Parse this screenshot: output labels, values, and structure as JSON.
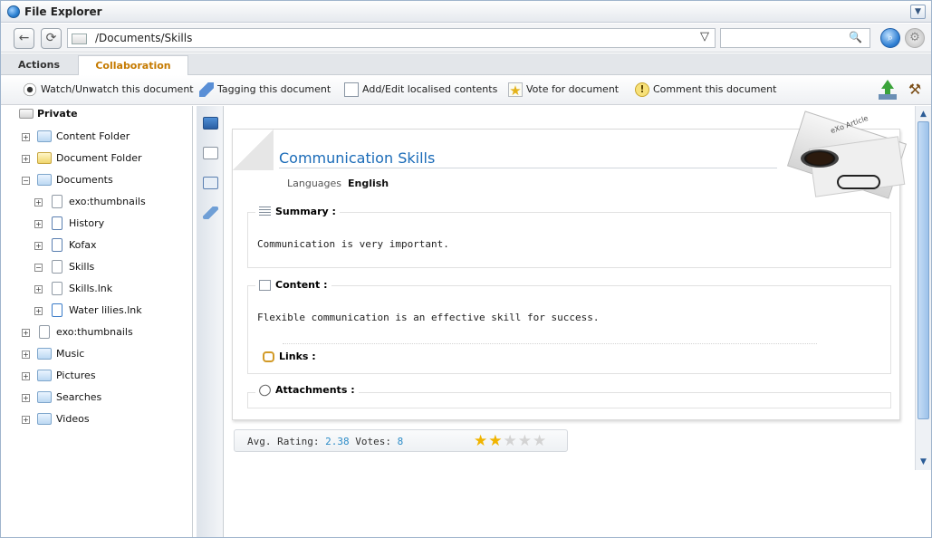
{
  "window": {
    "title": "File Explorer"
  },
  "address": {
    "path": "/Documents/Skills",
    "search_placeholder": ""
  },
  "tabs": [
    {
      "label": "Actions"
    },
    {
      "label": "Collaboration"
    }
  ],
  "toolbar": {
    "items": [
      {
        "label": "Watch/Unwatch this document",
        "icon": "eye-icon"
      },
      {
        "label": "Tagging this document",
        "icon": "tag-icon"
      },
      {
        "label": "Add/Edit localised contents",
        "icon": "localised-doc-icon"
      },
      {
        "label": "Vote for document",
        "icon": "vote-star-icon"
      },
      {
        "label": "Comment this document",
        "icon": "comment-icon"
      }
    ]
  },
  "tree": {
    "root": "Private",
    "items": [
      {
        "label": "Content Folder",
        "level": 1,
        "expanded": false
      },
      {
        "label": "Document Folder",
        "level": 1,
        "expanded": false
      },
      {
        "label": "Documents",
        "level": 1,
        "expanded": true
      },
      {
        "label": "exo:thumbnails",
        "level": 2,
        "expanded": false
      },
      {
        "label": "History",
        "level": 2,
        "expanded": false
      },
      {
        "label": "Kofax",
        "level": 2,
        "expanded": false
      },
      {
        "label": "Skills",
        "level": 2,
        "expanded": true
      },
      {
        "label": "Skills.lnk",
        "level": 2,
        "expanded": false
      },
      {
        "label": "Water lilies.lnk",
        "level": 2,
        "expanded": false
      },
      {
        "label": "exo:thumbnails",
        "level": 1,
        "expanded": false
      },
      {
        "label": "Music",
        "level": 1,
        "expanded": false
      },
      {
        "label": "Pictures",
        "level": 1,
        "expanded": false
      },
      {
        "label": "Searches",
        "level": 1,
        "expanded": false
      },
      {
        "label": "Videos",
        "level": 1,
        "expanded": false
      }
    ]
  },
  "document": {
    "title": "Communication Skills",
    "languages_label": "Languages",
    "language": "English",
    "art_tag": "eXo Article",
    "summary_label": "Summary :",
    "summary_text": "Communication is very important.",
    "content_label": "Content :",
    "content_text": "Flexible communication is an effective skill for success.",
    "links_label": "Links :",
    "attachments_label": "Attachments :"
  },
  "rating": {
    "avg_label": "Avg. Rating:",
    "avg_value": "2.38",
    "votes_label": "Votes:",
    "votes_value": "8",
    "stars_filled": 2,
    "stars_total": 5
  }
}
